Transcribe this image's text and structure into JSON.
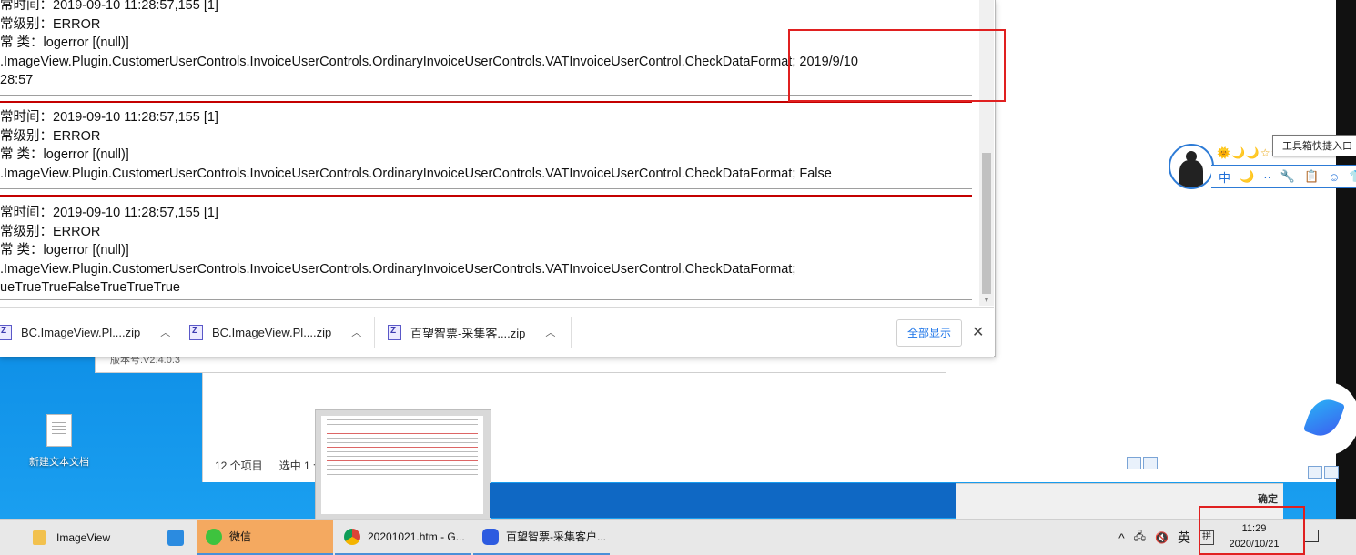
{
  "log_entries": [
    {
      "lines": [
        "常时间：2019-09-10 11:28:57,155 [1]",
        "常级别：ERROR",
        "常 类：logerror [(null)]",
        ".ImageView.Plugin.CustomerUserControls.InvoiceUserControls.OrdinaryInvoiceUserControls.VATInvoiceUserControl.CheckDataFormat; 2019/9/10",
        "28:57"
      ]
    },
    {
      "lines": [
        "常时间：2019-09-10 11:28:57,155 [1]",
        "常级别：ERROR",
        "常 类：logerror [(null)]",
        ".ImageView.Plugin.CustomerUserControls.InvoiceUserControls.OrdinaryInvoiceUserControls.VATInvoiceUserControl.CheckDataFormat; False"
      ]
    },
    {
      "lines": [
        "常时间：2019-09-10 11:28:57,155 [1]",
        "常级别：ERROR",
        "常 类：logerror [(null)]",
        ".ImageView.Plugin.CustomerUserControls.InvoiceUserControls.OrdinaryInvoiceUserControls.VATInvoiceUserControl.CheckDataFormat;",
        "ueTrueTrueFalseTrueTrueTrue"
      ]
    }
  ],
  "downloads": {
    "items": [
      "BC.ImageView.Pl....zip",
      "BC.ImageView.Pl....zip",
      "百望智票-采集客....zip"
    ],
    "show_all": "全部显示",
    "close": "✕"
  },
  "installer": {
    "version": "版本号:V2.4.0.3"
  },
  "explorer": {
    "item_count": "12 个项目",
    "selected": "选中 1 个"
  },
  "desktop": {
    "icon_label": "新建文本文档"
  },
  "qq": {
    "stars": "🌞🌙🌙☆☆",
    "tools": [
      "中",
      "🌙",
      "··",
      "🔧",
      "📋",
      "☺",
      "👕"
    ],
    "tooltip": "工具箱快捷入口"
  },
  "popup_strip": {
    "label": "确定"
  },
  "taskbar": {
    "items": [
      {
        "label": "ImageView"
      },
      {
        "label": ""
      },
      {
        "label": "微信"
      },
      {
        "label": "20201021.htm - G..."
      },
      {
        "label": "百望智票-采集客户..."
      }
    ],
    "tray": {
      "chevron": "^",
      "lang": "英",
      "ime": "拼"
    },
    "time": "11:29",
    "date": "2020/10/21"
  },
  "colors": {
    "accent": "#1a73e8",
    "highlight": "#e02020",
    "desktop": "#0a7fd8"
  }
}
